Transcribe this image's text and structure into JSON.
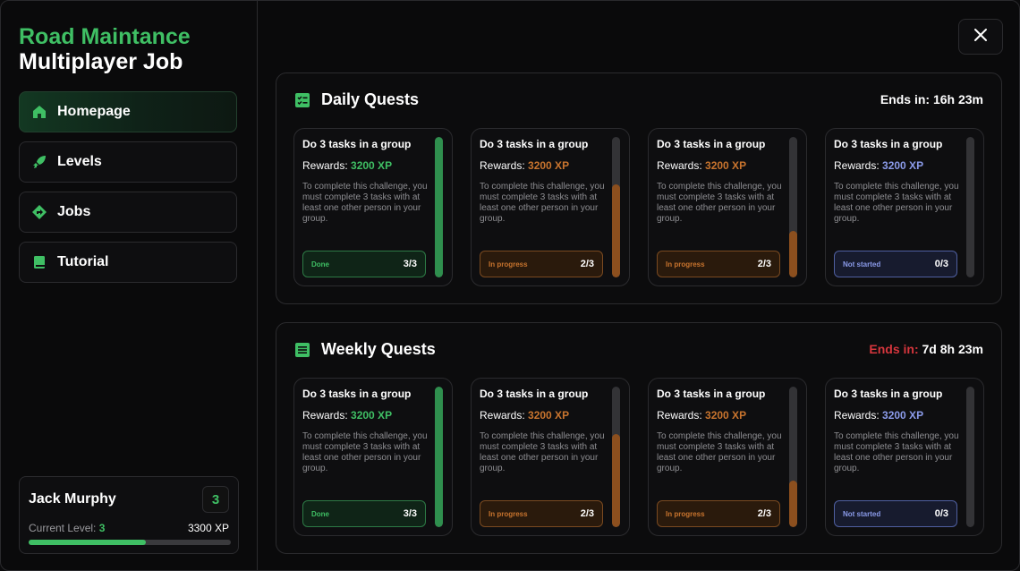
{
  "brand": {
    "line1": "Road Maintance",
    "line2": "Multiplayer Job"
  },
  "nav": [
    {
      "label": "Homepage",
      "icon": "home-icon",
      "active": true
    },
    {
      "label": "Levels",
      "icon": "rocket-icon",
      "active": false
    },
    {
      "label": "Jobs",
      "icon": "route-sign-icon",
      "active": false
    },
    {
      "label": "Tutorial",
      "icon": "book-icon",
      "active": false
    }
  ],
  "profile": {
    "name": "Jack Murphy",
    "level_badge": "3",
    "level_label": "Current Level: ",
    "level_value": "3",
    "xp": "3300 XP",
    "progress": 0.58
  },
  "close_icon": "close-icon",
  "daily": {
    "title": "Daily Quests",
    "ends_label": "Ends in: ",
    "ends_value": "16h 23m",
    "ends_label_color": "#ffffff",
    "icon": "checklist-icon"
  },
  "weekly": {
    "title": "Weekly Quests",
    "ends_label": "Ends in: ",
    "ends_value": "7d 8h 23m",
    "ends_label_color": "#d6363d",
    "icon": "list-icon"
  },
  "cards": [
    {
      "title": "Do 3 tasks in a group",
      "rewards_label": "Rewards: ",
      "rewards_value": "3200 XP",
      "description": "To complete this challenge, you must complete 3 tasks with at least one other person in your group.",
      "status": "Done",
      "count": "3/3",
      "progress": 1.0,
      "color": "#3fbf64",
      "bar_color": "#2f8f4e",
      "variant": "done"
    },
    {
      "title": "Do 3 tasks in a group",
      "rewards_label": "Rewards: ",
      "rewards_value": "3200 XP",
      "description": "To complete this challenge, you must complete 3 tasks with at least one other person in your group.",
      "status": "In progress",
      "count": "2/3",
      "progress": 0.66,
      "color": "#c8742e",
      "bar_color": "#8c4f1e",
      "variant": "prog"
    },
    {
      "title": "Do 3 tasks in a group",
      "rewards_label": "Rewards: ",
      "rewards_value": "3200 XP",
      "description": "To complete this challenge, you must complete 3 tasks with at least one other person in your group.",
      "status": "In progress",
      "count": "2/3",
      "progress": 0.33,
      "color": "#c8742e",
      "bar_color": "#8c4f1e",
      "variant": "prog"
    },
    {
      "title": "Do 3 tasks in a group",
      "rewards_label": "Rewards: ",
      "rewards_value": "3200 XP",
      "description": "To complete this challenge, you must complete 3 tasks with at least one other person in your group.",
      "status": "Not started",
      "count": "0/3",
      "progress": 0.0,
      "color": "#8b9bea",
      "bar_color": "#4f5fa0",
      "variant": "none"
    }
  ]
}
